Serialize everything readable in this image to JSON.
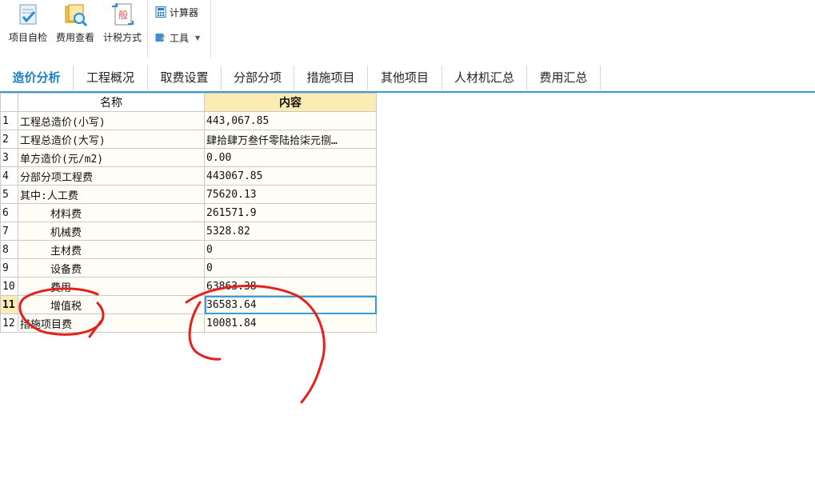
{
  "toolbar": {
    "buttons": [
      "项目自检",
      "费用查看",
      "计税方式"
    ],
    "small": [
      "计算器",
      "工具"
    ]
  },
  "tabs": [
    "造价分析",
    "工程概况",
    "取费设置",
    "分部分项",
    "措施项目",
    "其他项目",
    "人材机汇总",
    "费用汇总"
  ],
  "table": {
    "headers": [
      "名称",
      "内容"
    ],
    "rows": [
      {
        "idx": "1",
        "name": "工程总造价(小写)",
        "value": "443,067.85"
      },
      {
        "idx": "2",
        "name": "工程总造价(大写)",
        "value": "肆拾肆万叁仟零陆拾柒元捌…"
      },
      {
        "idx": "3",
        "name": "单方造价(元/m2)",
        "value": "0.00"
      },
      {
        "idx": "4",
        "name": "分部分项工程费",
        "value": "443067.85"
      },
      {
        "idx": "5",
        "name": "其中:人工费",
        "value": "75620.13"
      },
      {
        "idx": "6",
        "name": "材料费",
        "value": "261571.9"
      },
      {
        "idx": "7",
        "name": "机械费",
        "value": "5328.82"
      },
      {
        "idx": "8",
        "name": "主材费",
        "value": "0"
      },
      {
        "idx": "9",
        "name": "设备费",
        "value": "0"
      },
      {
        "idx": "10",
        "name": "费用",
        "value": "63863.38"
      },
      {
        "idx": "11",
        "name": "增值税",
        "value": "36583.64"
      },
      {
        "idx": "12",
        "name": "措施项目费",
        "value": "10081.84"
      }
    ]
  },
  "colors": {
    "accent": "#3a9bd9",
    "header_highlight": "#fbecb4",
    "annotation": "#e3201b"
  }
}
